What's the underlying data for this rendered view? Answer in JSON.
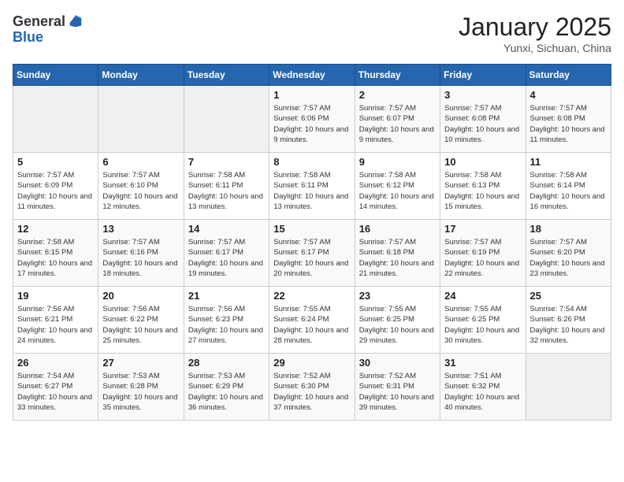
{
  "header": {
    "logo": {
      "general": "General",
      "blue": "Blue"
    },
    "title": "January 2025",
    "subtitle": "Yunxi, Sichuan, China"
  },
  "weekdays": [
    "Sunday",
    "Monday",
    "Tuesday",
    "Wednesday",
    "Thursday",
    "Friday",
    "Saturday"
  ],
  "weeks": [
    [
      {
        "day": "",
        "sunrise": "",
        "sunset": "",
        "daylight": ""
      },
      {
        "day": "",
        "sunrise": "",
        "sunset": "",
        "daylight": ""
      },
      {
        "day": "",
        "sunrise": "",
        "sunset": "",
        "daylight": ""
      },
      {
        "day": "1",
        "sunrise": "Sunrise: 7:57 AM",
        "sunset": "Sunset: 6:06 PM",
        "daylight": "Daylight: 10 hours and 9 minutes."
      },
      {
        "day": "2",
        "sunrise": "Sunrise: 7:57 AM",
        "sunset": "Sunset: 6:07 PM",
        "daylight": "Daylight: 10 hours and 9 minutes."
      },
      {
        "day": "3",
        "sunrise": "Sunrise: 7:57 AM",
        "sunset": "Sunset: 6:08 PM",
        "daylight": "Daylight: 10 hours and 10 minutes."
      },
      {
        "day": "4",
        "sunrise": "Sunrise: 7:57 AM",
        "sunset": "Sunset: 6:08 PM",
        "daylight": "Daylight: 10 hours and 11 minutes."
      }
    ],
    [
      {
        "day": "5",
        "sunrise": "Sunrise: 7:57 AM",
        "sunset": "Sunset: 6:09 PM",
        "daylight": "Daylight: 10 hours and 11 minutes."
      },
      {
        "day": "6",
        "sunrise": "Sunrise: 7:57 AM",
        "sunset": "Sunset: 6:10 PM",
        "daylight": "Daylight: 10 hours and 12 minutes."
      },
      {
        "day": "7",
        "sunrise": "Sunrise: 7:58 AM",
        "sunset": "Sunset: 6:11 PM",
        "daylight": "Daylight: 10 hours and 13 minutes."
      },
      {
        "day": "8",
        "sunrise": "Sunrise: 7:58 AM",
        "sunset": "Sunset: 6:11 PM",
        "daylight": "Daylight: 10 hours and 13 minutes."
      },
      {
        "day": "9",
        "sunrise": "Sunrise: 7:58 AM",
        "sunset": "Sunset: 6:12 PM",
        "daylight": "Daylight: 10 hours and 14 minutes."
      },
      {
        "day": "10",
        "sunrise": "Sunrise: 7:58 AM",
        "sunset": "Sunset: 6:13 PM",
        "daylight": "Daylight: 10 hours and 15 minutes."
      },
      {
        "day": "11",
        "sunrise": "Sunrise: 7:58 AM",
        "sunset": "Sunset: 6:14 PM",
        "daylight": "Daylight: 10 hours and 16 minutes."
      }
    ],
    [
      {
        "day": "12",
        "sunrise": "Sunrise: 7:58 AM",
        "sunset": "Sunset: 6:15 PM",
        "daylight": "Daylight: 10 hours and 17 minutes."
      },
      {
        "day": "13",
        "sunrise": "Sunrise: 7:57 AM",
        "sunset": "Sunset: 6:16 PM",
        "daylight": "Daylight: 10 hours and 18 minutes."
      },
      {
        "day": "14",
        "sunrise": "Sunrise: 7:57 AM",
        "sunset": "Sunset: 6:17 PM",
        "daylight": "Daylight: 10 hours and 19 minutes."
      },
      {
        "day": "15",
        "sunrise": "Sunrise: 7:57 AM",
        "sunset": "Sunset: 6:17 PM",
        "daylight": "Daylight: 10 hours and 20 minutes."
      },
      {
        "day": "16",
        "sunrise": "Sunrise: 7:57 AM",
        "sunset": "Sunset: 6:18 PM",
        "daylight": "Daylight: 10 hours and 21 minutes."
      },
      {
        "day": "17",
        "sunrise": "Sunrise: 7:57 AM",
        "sunset": "Sunset: 6:19 PM",
        "daylight": "Daylight: 10 hours and 22 minutes."
      },
      {
        "day": "18",
        "sunrise": "Sunrise: 7:57 AM",
        "sunset": "Sunset: 6:20 PM",
        "daylight": "Daylight: 10 hours and 23 minutes."
      }
    ],
    [
      {
        "day": "19",
        "sunrise": "Sunrise: 7:56 AM",
        "sunset": "Sunset: 6:21 PM",
        "daylight": "Daylight: 10 hours and 24 minutes."
      },
      {
        "day": "20",
        "sunrise": "Sunrise: 7:56 AM",
        "sunset": "Sunset: 6:22 PM",
        "daylight": "Daylight: 10 hours and 25 minutes."
      },
      {
        "day": "21",
        "sunrise": "Sunrise: 7:56 AM",
        "sunset": "Sunset: 6:23 PM",
        "daylight": "Daylight: 10 hours and 27 minutes."
      },
      {
        "day": "22",
        "sunrise": "Sunrise: 7:55 AM",
        "sunset": "Sunset: 6:24 PM",
        "daylight": "Daylight: 10 hours and 28 minutes."
      },
      {
        "day": "23",
        "sunrise": "Sunrise: 7:55 AM",
        "sunset": "Sunset: 6:25 PM",
        "daylight": "Daylight: 10 hours and 29 minutes."
      },
      {
        "day": "24",
        "sunrise": "Sunrise: 7:55 AM",
        "sunset": "Sunset: 6:25 PM",
        "daylight": "Daylight: 10 hours and 30 minutes."
      },
      {
        "day": "25",
        "sunrise": "Sunrise: 7:54 AM",
        "sunset": "Sunset: 6:26 PM",
        "daylight": "Daylight: 10 hours and 32 minutes."
      }
    ],
    [
      {
        "day": "26",
        "sunrise": "Sunrise: 7:54 AM",
        "sunset": "Sunset: 6:27 PM",
        "daylight": "Daylight: 10 hours and 33 minutes."
      },
      {
        "day": "27",
        "sunrise": "Sunrise: 7:53 AM",
        "sunset": "Sunset: 6:28 PM",
        "daylight": "Daylight: 10 hours and 35 minutes."
      },
      {
        "day": "28",
        "sunrise": "Sunrise: 7:53 AM",
        "sunset": "Sunset: 6:29 PM",
        "daylight": "Daylight: 10 hours and 36 minutes."
      },
      {
        "day": "29",
        "sunrise": "Sunrise: 7:52 AM",
        "sunset": "Sunset: 6:30 PM",
        "daylight": "Daylight: 10 hours and 37 minutes."
      },
      {
        "day": "30",
        "sunrise": "Sunrise: 7:52 AM",
        "sunset": "Sunset: 6:31 PM",
        "daylight": "Daylight: 10 hours and 39 minutes."
      },
      {
        "day": "31",
        "sunrise": "Sunrise: 7:51 AM",
        "sunset": "Sunset: 6:32 PM",
        "daylight": "Daylight: 10 hours and 40 minutes."
      },
      {
        "day": "",
        "sunrise": "",
        "sunset": "",
        "daylight": ""
      }
    ]
  ]
}
